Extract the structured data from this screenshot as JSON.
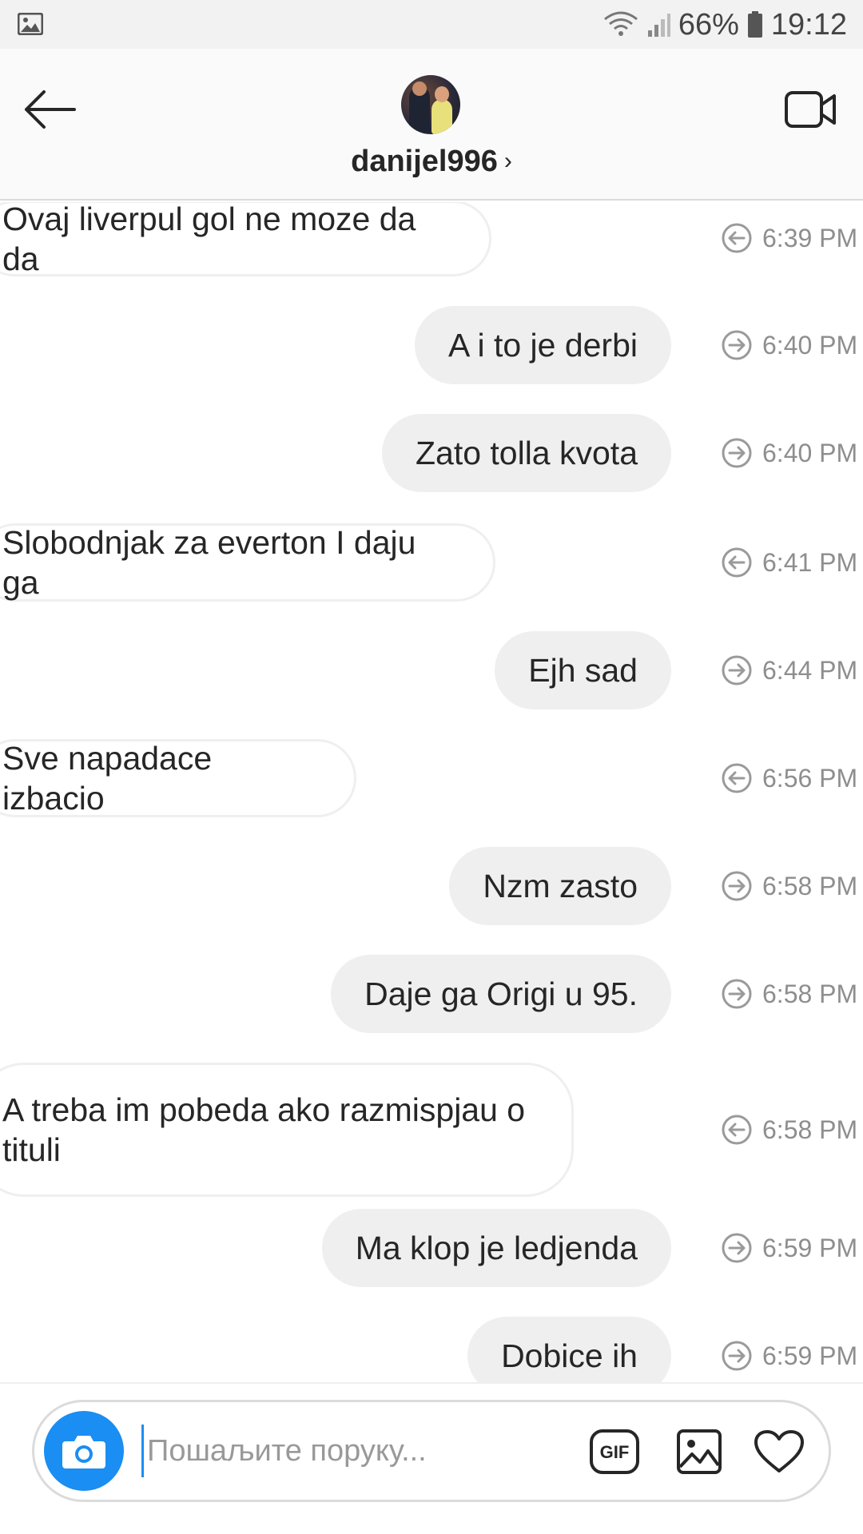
{
  "status_bar": {
    "battery_percent": "66%",
    "time": "19:12",
    "icons": [
      "gallery-icon",
      "wifi-icon",
      "signal-icon",
      "battery-icon"
    ]
  },
  "header": {
    "username": "danijel996",
    "chevron": "›",
    "icons": [
      "back-arrow-icon",
      "avatar",
      "video-call-icon"
    ]
  },
  "messages": [
    {
      "direction": "in",
      "text": "Ovaj liverpul gol ne moze da da",
      "time": "6:39 PM"
    },
    {
      "direction": "out",
      "text": "A i to je derbi",
      "time": "6:40 PM"
    },
    {
      "direction": "out",
      "text": "Zato tolla kvota",
      "time": "6:40 PM"
    },
    {
      "direction": "in",
      "text": "Slobodnjak za everton I daju ga",
      "time": "6:41 PM"
    },
    {
      "direction": "out",
      "text": "Ejh sad",
      "time": "6:44 PM"
    },
    {
      "direction": "in",
      "text": "Sve napadace izbacio",
      "time": "6:56 PM"
    },
    {
      "direction": "out",
      "text": "Nzm zasto",
      "time": "6:58 PM"
    },
    {
      "direction": "out",
      "text": "Daje ga Origi u 95.",
      "time": "6:58 PM"
    },
    {
      "direction": "in",
      "text_lines": [
        "A treba im pobeda ako razmispjau o",
        "tituli"
      ],
      "time": "6:58 PM"
    },
    {
      "direction": "out",
      "text": "Ma klop je ledjenda",
      "time": "6:59 PM"
    },
    {
      "direction": "out",
      "text": "Dobice ih",
      "time": "6:59 PM"
    }
  ],
  "composer": {
    "placeholder": "Пошаљите поруку...",
    "icons": [
      "camera-icon",
      "gif-icon",
      "image-icon",
      "heart-icon"
    ],
    "gif_label": "GIF"
  },
  "colors": {
    "accent": "#1a8ef2",
    "incoming_bubble_border": "#efefef",
    "outgoing_bubble_bg": "#efefef",
    "timestamp": "#8e8e8e",
    "text": "#262626"
  }
}
